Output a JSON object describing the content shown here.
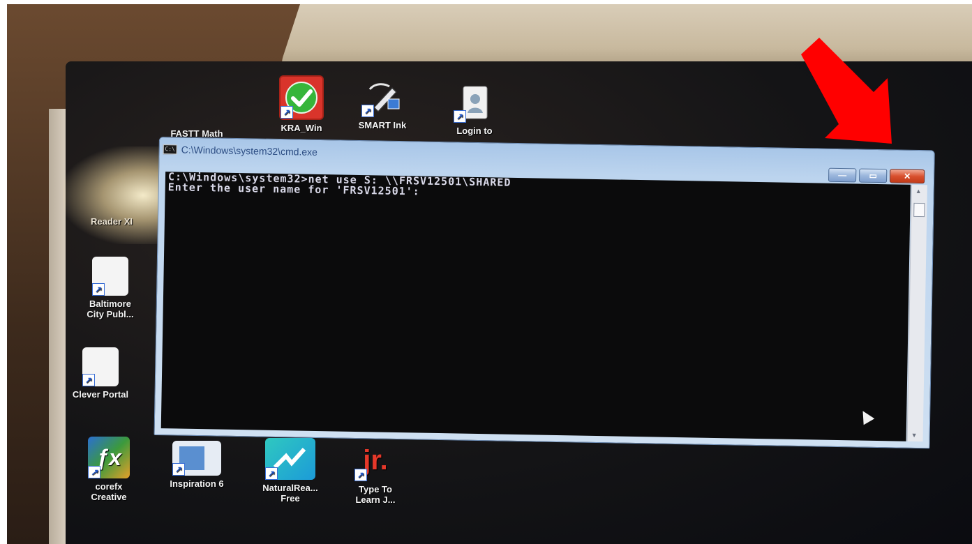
{
  "desktop": {
    "top_icons": [
      {
        "label": "FASTT Math",
        "icon": "fastt-math-icon"
      },
      {
        "label": "KRA_Win",
        "icon": "green-checkmark-icon"
      },
      {
        "label": "SMART Ink",
        "icon": "smart-ink-pen-icon"
      },
      {
        "label": "Login to",
        "icon": "login-badge-icon"
      }
    ],
    "left_icons": [
      {
        "label": "Reader XI",
        "icon": "pdf-reader-icon"
      },
      {
        "label": "Baltimore City Publ...",
        "line1": "Baltimore",
        "line2": "City Publ...",
        "icon": "document-shortcut-icon"
      },
      {
        "label": "Clever Portal",
        "icon": "document-shortcut-icon"
      }
    ],
    "bottom_icons": [
      {
        "line1": "corefx",
        "line2": "Creative",
        "icon": "corefx-icon"
      },
      {
        "line1": "Inspiration 6",
        "line2": "",
        "icon": "inspiration-icon"
      },
      {
        "line1": "NaturalRea...",
        "line2": "Free",
        "icon": "naturalreader-icon"
      },
      {
        "line1": "Type To",
        "line2": "Learn J...",
        "icon": "type-to-learn-icon"
      }
    ]
  },
  "cmd_window": {
    "title": "C:\\Windows\\system32\\cmd.exe",
    "app_icon_text": "C:\\",
    "minimize_symbol": "—",
    "maximize_symbol": "▭",
    "close_symbol": "✕",
    "console_lines": [
      "C:\\Windows\\system32>net use S: \\\\FRSV12501\\SHARED",
      "Enter the user name for 'FRSV12501':"
    ]
  },
  "colors": {
    "annotation_arrow": "#ff0000",
    "console_background": "#0b0b0c",
    "console_text": "#d8d8e8",
    "title_text": "#2d4e84"
  }
}
